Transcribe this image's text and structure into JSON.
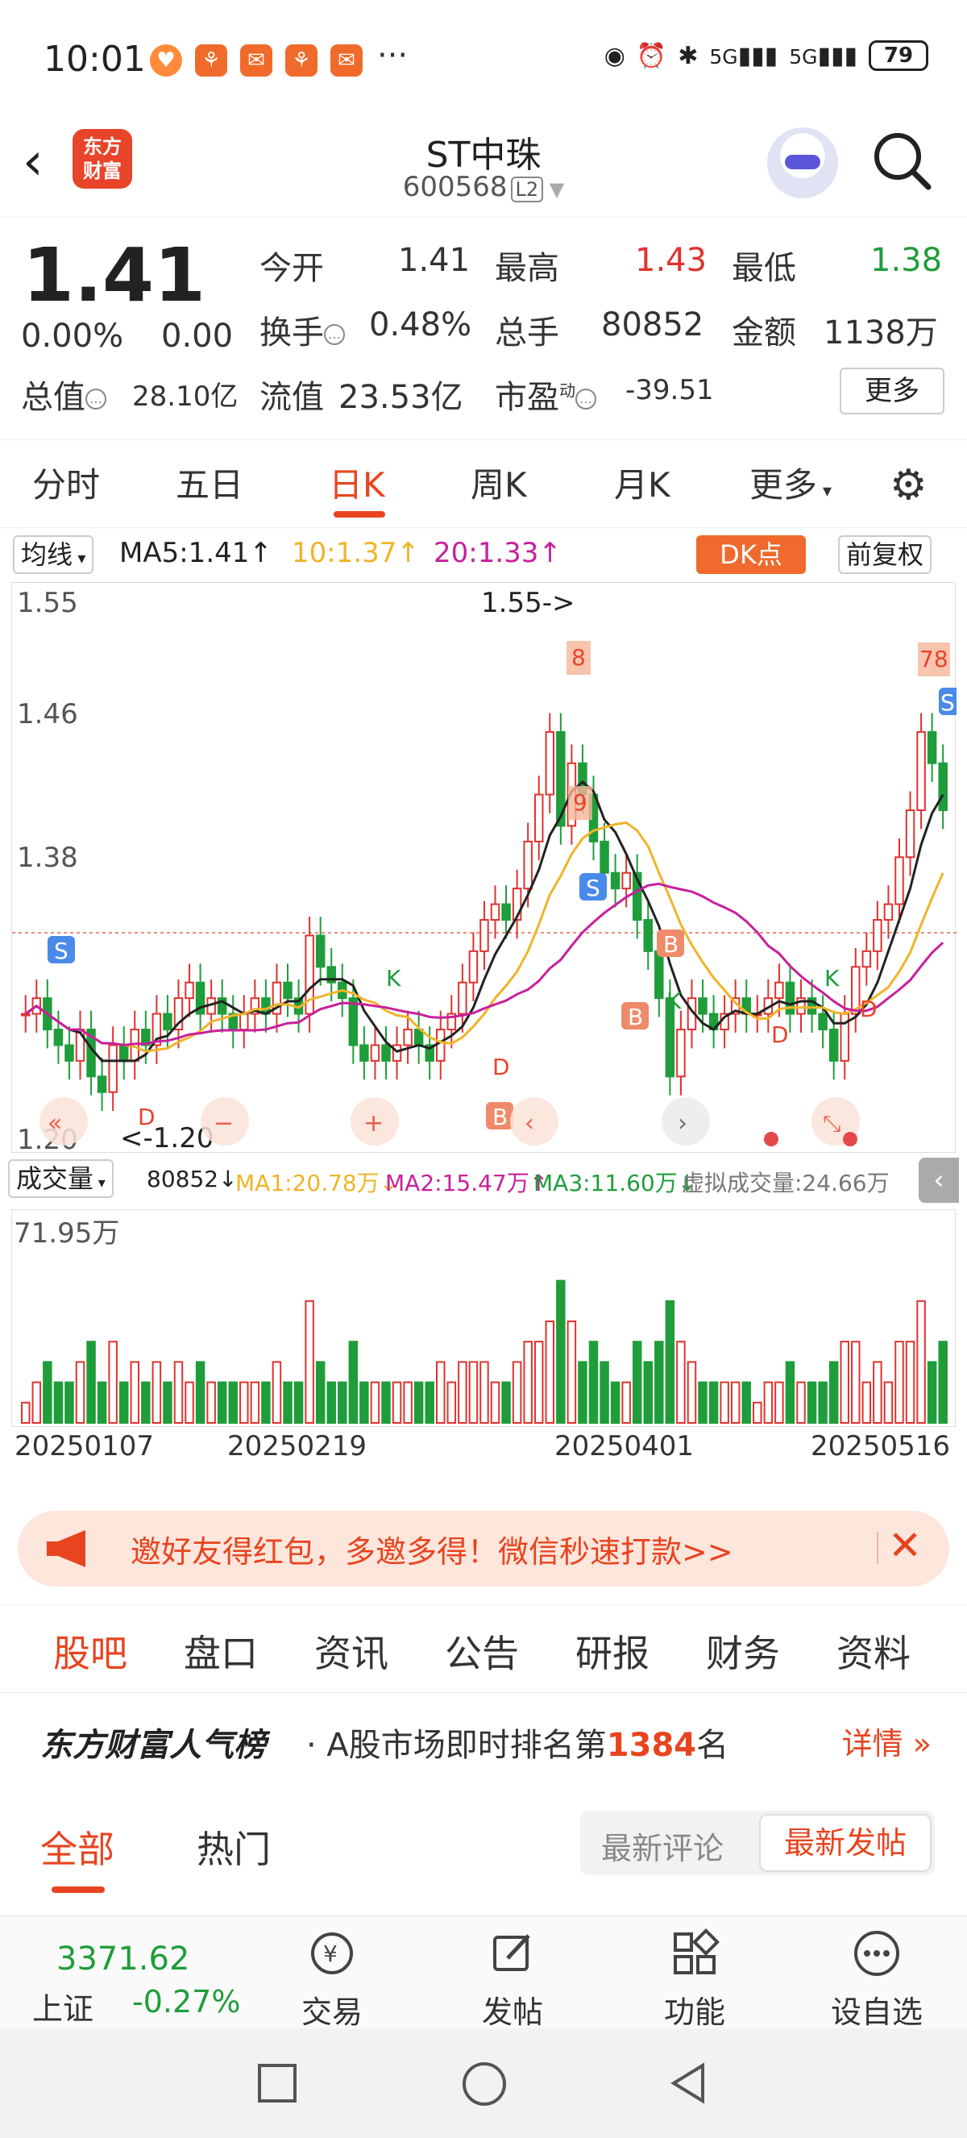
{
  "status": {
    "time": "10:01",
    "dots": "···",
    "battery": "79",
    "net1": "5G",
    "net2": "5G"
  },
  "header": {
    "logo_line1": "东方",
    "logo_line2": "财富",
    "title": "ST中珠",
    "code": "600568",
    "level": "L2"
  },
  "quote": {
    "price": "1.41",
    "change_pct": "0.00%",
    "change": "0.00",
    "open_label": "今开",
    "open": "1.41",
    "high_label": "最高",
    "high": "1.43",
    "low_label": "最低",
    "low": "1.38",
    "turnover_label": "换手",
    "turnover": "0.48%",
    "volume_label": "总手",
    "volume": "80852",
    "amount_label": "金额",
    "amount": "1138万",
    "mktcap_label": "总值",
    "mktcap": "28.10亿",
    "float_label": "流值",
    "float": "23.53亿",
    "pe_label": "市盈",
    "pe_sup": "动",
    "pe": "-39.51",
    "more": "更多"
  },
  "ktabs": [
    "分时",
    "五日",
    "日K",
    "周K",
    "月K",
    "更多"
  ],
  "ma": {
    "selector": "均线",
    "ma5": "MA5:1.41",
    "ma10": "10:1.37",
    "ma20": "20:1.33",
    "dk": "DK点",
    "adjust": "前复权",
    "color5": "#222222",
    "color10": "#f0b429",
    "color20": "#c7209c"
  },
  "chart_data": {
    "type": "candlestick",
    "y_axis_labels": [
      "1.55",
      "1.46",
      "1.38",
      "1.20"
    ],
    "max_annotation": "1.55->",
    "min_annotation": "<-1.20",
    "ylim": [
      1.2,
      1.55
    ],
    "x_axis_labels": [
      "20250107",
      "20250219",
      "20250401",
      "20250516"
    ],
    "volume_axis_label": "71.95万",
    "closes": [
      1.28,
      1.29,
      1.27,
      1.26,
      1.25,
      1.27,
      1.24,
      1.23,
      1.26,
      1.25,
      1.27,
      1.26,
      1.28,
      1.27,
      1.29,
      1.3,
      1.28,
      1.29,
      1.28,
      1.27,
      1.28,
      1.29,
      1.28,
      1.3,
      1.29,
      1.28,
      1.33,
      1.31,
      1.3,
      1.29,
      1.26,
      1.25,
      1.26,
      1.25,
      1.26,
      1.27,
      1.26,
      1.25,
      1.27,
      1.28,
      1.3,
      1.32,
      1.34,
      1.35,
      1.34,
      1.36,
      1.39,
      1.42,
      1.46,
      1.4,
      1.44,
      1.42,
      1.39,
      1.37,
      1.36,
      1.37,
      1.34,
      1.32,
      1.29,
      1.24,
      1.27,
      1.29,
      1.28,
      1.27,
      1.28,
      1.29,
      1.28,
      1.28,
      1.29,
      1.3,
      1.28,
      1.29,
      1.28,
      1.27,
      1.25,
      1.28,
      1.31,
      1.32,
      1.34,
      1.35,
      1.38,
      1.41,
      1.46,
      1.44,
      1.41
    ]
  },
  "volume": {
    "selector": "成交量",
    "vol": "80852",
    "ma1": "MA1:20.78万",
    "ma2": "MA2:15.47万",
    "ma3": "MA3:11.60万",
    "virtual": "虚拟成交量:24.66万"
  },
  "invite": {
    "text": "邀好友得红包，多邀多得！微信秒速打款>>"
  },
  "subtabs": [
    "股吧",
    "盘口",
    "资讯",
    "公告",
    "研报",
    "财务",
    "资料"
  ],
  "rank": {
    "brand": "东方财富人气榜",
    "desc_prefix": "· A股市场即时排名第",
    "rank": "1384",
    "desc_suffix": "名",
    "detail": "详情 »"
  },
  "ftabs": [
    "全部",
    "热门"
  ],
  "sort": {
    "latest_comment": "最新评论",
    "latest_post": "最新发帖"
  },
  "bottom": {
    "index_value": "3371.62",
    "index_name": "上证",
    "index_change": "-0.27%",
    "trade": "交易",
    "post": "发帖",
    "func": "功能",
    "watch": "设自选"
  }
}
